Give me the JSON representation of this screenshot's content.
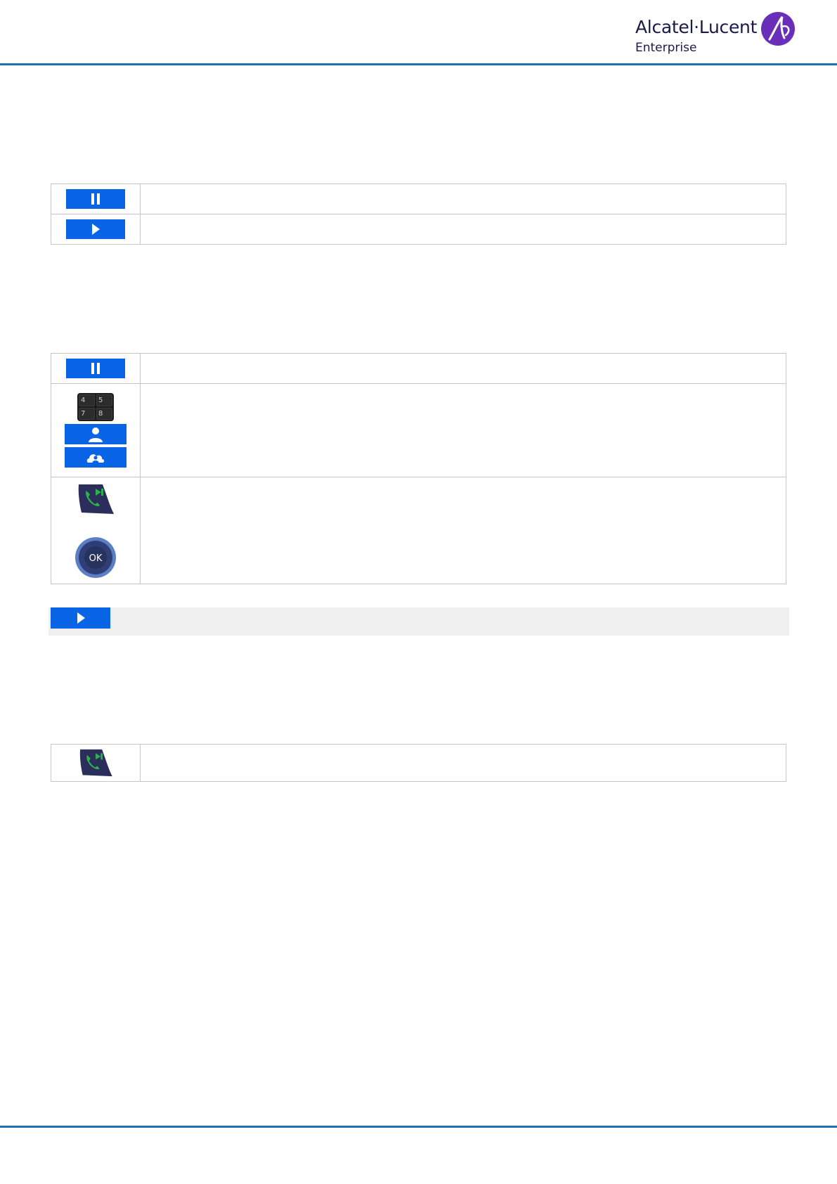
{
  "header": {
    "brand_name": "Alcatel·Lucent",
    "brand_sub": "Enterprise",
    "colors": {
      "brand_text": "#1a1a4a",
      "logo_circle": "#6a2fb8",
      "rule": "#1f6fb4"
    }
  },
  "icons": {
    "pause_key": "pause-icon",
    "play_key": "play-icon",
    "keypad": "keypad-icon",
    "contact_key": "person-icon",
    "directory_key": "directory-icon",
    "offhook_key": "offhook-call-icon",
    "ok_key": "ok-button-icon"
  },
  "keypad_labels": [
    "4",
    "5",
    "7",
    "8"
  ],
  "ok_label": "OK",
  "colors": {
    "key_blue": "#0a64e6",
    "table_border": "#c6c6c6",
    "note_background": "#f0f0f0",
    "handset_green": "#2bb24c",
    "handset_body": "#2b2d5a"
  }
}
